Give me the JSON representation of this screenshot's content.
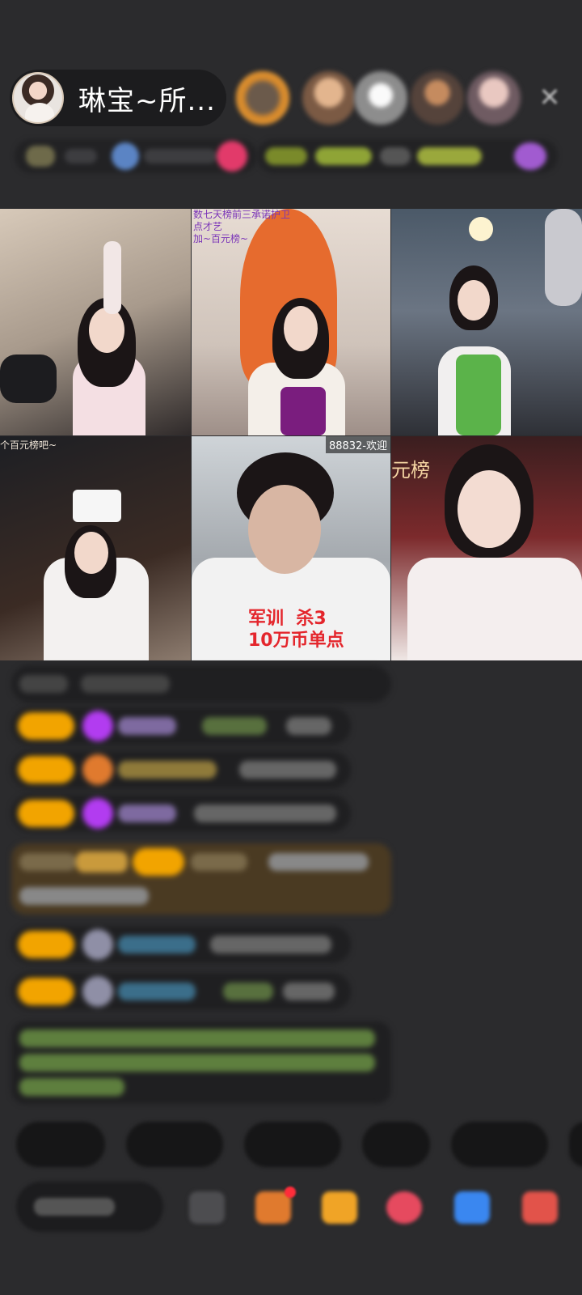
{
  "header": {
    "host_name": "琳宝~所...",
    "close_icon": "close-icon"
  },
  "video_tiles": [
    {
      "id": "tile-1",
      "caption": ""
    },
    {
      "id": "tile-2",
      "caption_line1": "数七天榜前三承诺护卫",
      "caption_line2": "点才艺",
      "caption_line3": "加~百元榜~"
    },
    {
      "id": "tile-3",
      "caption": ""
    },
    {
      "id": "tile-4",
      "caption": "个百元榜吧~"
    },
    {
      "id": "tile-5",
      "overlay_top": "88832-欢迎",
      "overlay_bottom": "军训  杀3\n10万币单点"
    },
    {
      "id": "tile-6",
      "caption": "元榜"
    }
  ],
  "colors": {
    "background": "#2b2b2d",
    "pill": "#1c1c1e",
    "level_badge": "#f2a400",
    "vip_purple": "#b23cf0",
    "warning_red": "#e4262c"
  }
}
